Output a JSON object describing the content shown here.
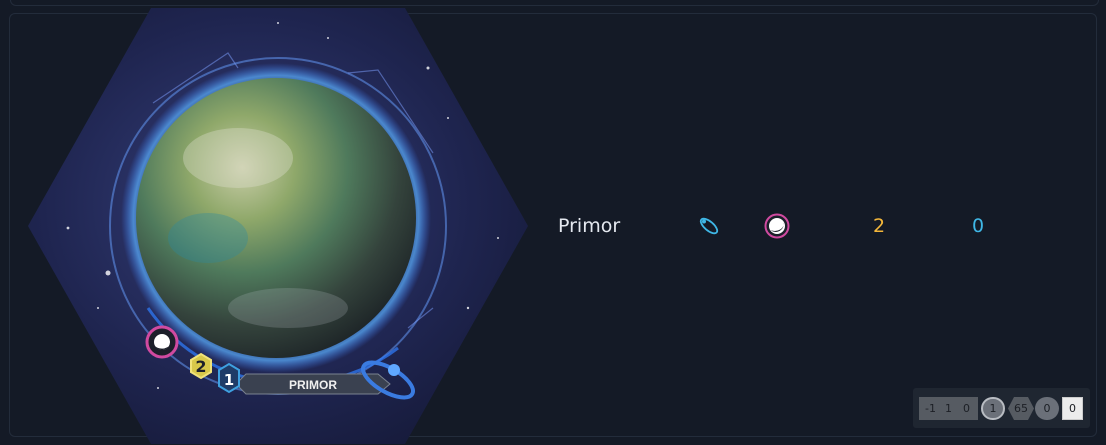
{
  "planet": {
    "name": "Primor",
    "tile_label": "PRIMOR",
    "trait_icon": "cultural-trait-icon",
    "tech_icon": "yin-yang-tech-skip-icon",
    "resources": "2",
    "influence": "0",
    "tile_resources": "2",
    "tile_influence": "1"
  },
  "codes": {
    "c1": [
      "-1",
      "1",
      "0"
    ],
    "c2": "1",
    "c3": "65",
    "c4": "0",
    "c5": "0"
  },
  "colors": {
    "background": "#141a26",
    "resources": "#f4b73a",
    "influence": "#3fb7e6",
    "tech_ring": "#d04aa0"
  }
}
